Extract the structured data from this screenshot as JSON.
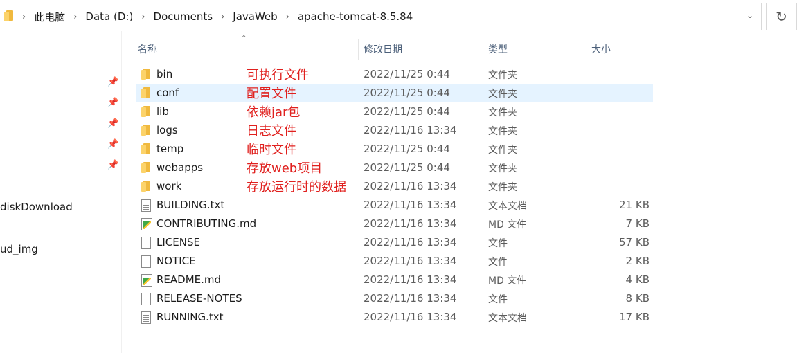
{
  "breadcrumb": [
    "此电脑",
    "Data (D:)",
    "Documents",
    "JavaWeb",
    "apache-tomcat-8.5.84"
  ],
  "nav": {
    "items": [
      "diskDownload",
      "ud_img"
    ]
  },
  "columns": {
    "name": "名称",
    "date": "修改日期",
    "type": "类型",
    "size": "大小"
  },
  "rows": [
    {
      "name": "bin",
      "date": "2022/11/25 0:44",
      "type": "文件夹",
      "size": "",
      "icon": "folder-icon",
      "note": "可执行文件"
    },
    {
      "name": "conf",
      "date": "2022/11/25 0:44",
      "type": "文件夹",
      "size": "",
      "icon": "folder-icon",
      "note": "配置文件"
    },
    {
      "name": "lib",
      "date": "2022/11/25 0:44",
      "type": "文件夹",
      "size": "",
      "icon": "folder-icon",
      "note": "依赖jar包"
    },
    {
      "name": "logs",
      "date": "2022/11/16 13:34",
      "type": "文件夹",
      "size": "",
      "icon": "folder-icon",
      "note": "日志文件"
    },
    {
      "name": "temp",
      "date": "2022/11/25 0:44",
      "type": "文件夹",
      "size": "",
      "icon": "folder-icon",
      "note": "临时文件"
    },
    {
      "name": "webapps",
      "date": "2022/11/25 0:44",
      "type": "文件夹",
      "size": "",
      "icon": "folder-icon",
      "note": "存放web项目"
    },
    {
      "name": "work",
      "date": "2022/11/16 13:34",
      "type": "文件夹",
      "size": "",
      "icon": "folder-icon",
      "note": "存放运行时的数据"
    },
    {
      "name": "BUILDING.txt",
      "date": "2022/11/16 13:34",
      "type": "文本文档",
      "size": "21 KB",
      "icon": "text-file-icon",
      "note": ""
    },
    {
      "name": "CONTRIBUTING.md",
      "date": "2022/11/16 13:34",
      "type": "MD 文件",
      "size": "7 KB",
      "icon": "markdown-file-icon",
      "note": ""
    },
    {
      "name": "LICENSE",
      "date": "2022/11/16 13:34",
      "type": "文件",
      "size": "57 KB",
      "icon": "file-icon",
      "note": ""
    },
    {
      "name": "NOTICE",
      "date": "2022/11/16 13:34",
      "type": "文件",
      "size": "2 KB",
      "icon": "file-icon",
      "note": ""
    },
    {
      "name": "README.md",
      "date": "2022/11/16 13:34",
      "type": "MD 文件",
      "size": "4 KB",
      "icon": "markdown-file-icon",
      "note": ""
    },
    {
      "name": "RELEASE-NOTES",
      "date": "2022/11/16 13:34",
      "type": "文件",
      "size": "8 KB",
      "icon": "file-icon",
      "note": ""
    },
    {
      "name": "RUNNING.txt",
      "date": "2022/11/16 13:34",
      "type": "文本文档",
      "size": "17 KB",
      "icon": "text-file-icon",
      "note": ""
    }
  ],
  "selected_row": "conf",
  "colors": {
    "selection": "#e5f3ff",
    "annotation": "#e0201e",
    "header_text": "#4c607a"
  }
}
